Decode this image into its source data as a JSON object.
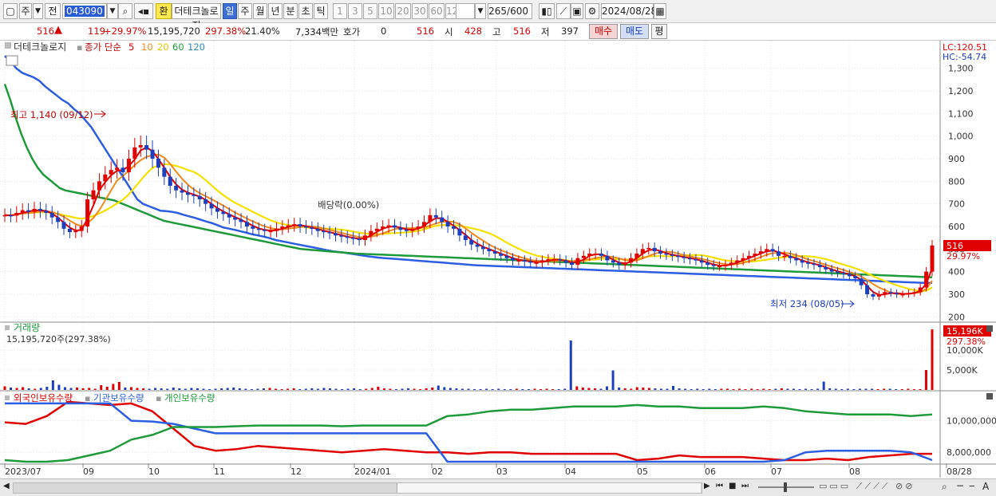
{
  "toolbar": {
    "unit": "주",
    "prefix": "전",
    "code": "043090",
    "currency_btn": "환",
    "stock_name": "더테크놀로지",
    "periods": [
      "일",
      "주",
      "월",
      "년",
      "분",
      "초",
      "틱"
    ],
    "intervals": [
      "1",
      "3",
      "5",
      "10",
      "20",
      "30",
      "60",
      "120"
    ],
    "count": "265",
    "count_total": "/600",
    "date": "2024/08/28"
  },
  "quote": {
    "price": "516",
    "change": "119",
    "change_pct": "+29.97%",
    "volume": "15,195,720",
    "volume_ratio": "297.38%",
    "turnover": "21.40%",
    "amount": "7,334백만",
    "hoga_label": "호가",
    "hoga_value": "0",
    "hoga_price": "516",
    "open_label": "시",
    "open": "428",
    "high_label": "고",
    "high": "516",
    "low_label": "저",
    "low": "397",
    "buy_btn": "매수",
    "sell_btn": "매도",
    "eval_btn": "평"
  },
  "colors": {
    "up": "#e00000",
    "down": "#1b3fbf",
    "ma5": "#e00000",
    "ma10": "#f08a1a",
    "ma20": "#f5e000",
    "ma60": "#1f9a3a",
    "ma120": "#2b5ee0",
    "foreign": "#e00000",
    "inst": "#2b5ee0",
    "retail": "#1f9a3a"
  },
  "chart_data": [
    {
      "type": "candlestick",
      "title": "더테크놀로지",
      "legend": [
        "종가 단순",
        "5",
        "10",
        "20",
        "60",
        "120"
      ],
      "ylim": [
        180,
        1380
      ],
      "y_ticks": [
        "1,300",
        "1,200",
        "1,100",
        "1,000",
        "900",
        "800",
        "700",
        "600",
        "500",
        "400",
        "300",
        "200"
      ],
      "x_ticks": [
        "2023/07",
        "09",
        "10",
        "11",
        "12",
        "2024/01",
        "02",
        "03",
        "04",
        "05",
        "06",
        "07",
        "08",
        "08/28"
      ],
      "lc": "LC:120.51",
      "hc": "HC:-54.74",
      "last_price": "516",
      "last_change": "29.97%",
      "annotations": {
        "high": "최고 1,140 (09/12)",
        "low": "최저 234 (08/05)",
        "dividend": "배당락(0.00%)"
      },
      "close": [
        650,
        648,
        660,
        672,
        665,
        678,
        670,
        660,
        640,
        620,
        590,
        575,
        580,
        600,
        720,
        760,
        800,
        830,
        850,
        860,
        840,
        900,
        950,
        960,
        940,
        900,
        860,
        820,
        780,
        760,
        750,
        740,
        735,
        720,
        700,
        680,
        665,
        655,
        640,
        630,
        620,
        600,
        590,
        585,
        580,
        580,
        590,
        600,
        605,
        610,
        600,
        595,
        590,
        580,
        575,
        570,
        560,
        555,
        550,
        545,
        540,
        560,
        580,
        590,
        600,
        605,
        595,
        585,
        580,
        590,
        600,
        620,
        650,
        640,
        620,
        600,
        590,
        560,
        540,
        520,
        510,
        500,
        490,
        480,
        470,
        460,
        450,
        450,
        445,
        440,
        440,
        450,
        455,
        455,
        450,
        440,
        430,
        460,
        470,
        480,
        480,
        470,
        450,
        440,
        430,
        440,
        460,
        480,
        500,
        505,
        490,
        480,
        475,
        470,
        465,
        460,
        455,
        450,
        440,
        430,
        425,
        425,
        430,
        440,
        450,
        460,
        470,
        480,
        490,
        500,
        490,
        470,
        470,
        460,
        450,
        440,
        435,
        430,
        420,
        410,
        400,
        395,
        390,
        380,
        370,
        340,
        300,
        290,
        300,
        310,
        305,
        300,
        300,
        305,
        310,
        330,
        400,
        516
      ],
      "ma120": [
        1355,
        1330,
        1300,
        1280,
        1270,
        1260,
        1245,
        1220,
        1200,
        1180,
        1160,
        1145,
        1120,
        1100,
        1070,
        1040,
        1000,
        960,
        920,
        880,
        840,
        800,
        760,
        720,
        700,
        690,
        680,
        670,
        668,
        665,
        660,
        652,
        645,
        638,
        630,
        622,
        615,
        605,
        595,
        590,
        585,
        578,
        572,
        565,
        560,
        555,
        548,
        540,
        535,
        530,
        525,
        520,
        515,
        510,
        505,
        500,
        495,
        490,
        487,
        484,
        480,
        476,
        472,
        468,
        465,
        462,
        460,
        458,
        456,
        454,
        452,
        450,
        448,
        446,
        444,
        442,
        440,
        438,
        436,
        434,
        432,
        430,
        428,
        427,
        426,
        425,
        424,
        423,
        422,
        421,
        420,
        419,
        418,
        417,
        416,
        415,
        414,
        413,
        412,
        411,
        410,
        409,
        408,
        407,
        406,
        405,
        404,
        403,
        402,
        401,
        400,
        399,
        398,
        397,
        396,
        395,
        394,
        393,
        392,
        391,
        390,
        389,
        388,
        387,
        386,
        385,
        384,
        383,
        382,
        381,
        380,
        379,
        378,
        377,
        376,
        375,
        374,
        373,
        372,
        371,
        370,
        369,
        368,
        367,
        366,
        365,
        364,
        363,
        362,
        361,
        360,
        359,
        358,
        357,
        356,
        355,
        354,
        353,
        352,
        351,
        350,
        350
      ],
      "ma60": [
        1230,
        1160,
        1080,
        1010,
        950,
        900,
        860,
        830,
        810,
        790,
        770,
        760,
        755,
        750,
        745,
        740,
        735,
        730,
        725,
        720,
        715,
        705,
        695,
        685,
        675,
        665,
        655,
        645,
        635,
        625,
        620,
        615,
        610,
        605,
        600,
        595,
        590,
        585,
        580,
        575,
        570,
        565,
        560,
        555,
        550,
        545,
        540,
        535,
        530,
        525,
        520,
        515,
        510,
        505,
        500,
        498,
        496,
        494,
        492,
        490,
        488,
        486,
        484,
        482,
        480,
        479,
        478,
        477,
        476,
        475,
        474,
        473,
        472,
        471,
        470,
        469,
        468,
        467,
        466,
        465,
        464,
        463,
        462,
        461,
        460,
        459,
        458,
        457,
        456,
        455,
        454,
        453,
        452,
        451,
        450,
        449,
        448,
        447,
        446,
        445,
        444,
        443,
        442,
        441,
        440,
        439,
        438,
        437,
        436,
        435,
        434,
        433,
        432,
        431,
        430,
        429,
        428,
        427,
        426,
        425,
        424,
        423,
        422,
        421,
        420,
        419,
        418,
        417,
        416,
        415,
        414,
        413,
        412,
        411,
        410,
        409,
        408,
        407,
        406,
        405,
        404,
        403,
        402,
        401,
        400,
        399,
        398,
        397,
        396,
        395,
        394,
        393,
        392,
        391,
        390,
        389,
        388,
        387,
        386,
        385,
        384,
        383,
        382,
        381,
        380,
        379,
        378,
        377,
        376,
        375
      ]
    },
    {
      "type": "bar",
      "title": "거래량",
      "value_label": "15,195,720주(297.38%)",
      "last_label": "15,196K",
      "last_pct": "297.38%",
      "y_ticks": [
        "10,000K",
        "5,000K"
      ],
      "ylim": [
        0,
        16000
      ],
      "values": [
        900,
        600,
        500,
        700,
        400,
        300,
        500,
        800,
        2400,
        1300,
        700,
        500,
        600,
        400,
        500,
        300,
        1200,
        800,
        1500,
        2000,
        600,
        700,
        500,
        400,
        300,
        500,
        400,
        300,
        600,
        400,
        300,
        500,
        400,
        300,
        200,
        300,
        400,
        500,
        600,
        400,
        300,
        200,
        300,
        400,
        500,
        300,
        200,
        300,
        400,
        200,
        300,
        400,
        300,
        500,
        400,
        300,
        200,
        300,
        400,
        200,
        300,
        500,
        800,
        400,
        300,
        200,
        300,
        400,
        300,
        200,
        400,
        600,
        1100,
        700,
        500,
        400,
        300,
        300,
        200,
        200,
        300,
        200,
        300,
        200,
        200,
        300,
        200,
        200,
        300,
        200,
        300,
        200,
        200,
        300,
        12400,
        900,
        600,
        500,
        400,
        300,
        900,
        4900,
        600,
        400,
        300,
        700,
        600,
        500,
        400,
        300,
        300,
        1000,
        400,
        300,
        200,
        300,
        200,
        300,
        200,
        300,
        300,
        200,
        300,
        200,
        300,
        200,
        300,
        200,
        300,
        400,
        300,
        300,
        200,
        300,
        200,
        300,
        2100,
        400,
        300,
        200,
        300,
        200,
        300,
        300,
        300,
        200,
        300,
        300,
        200,
        200,
        300,
        200,
        200,
        5000,
        15196
      ]
    },
    {
      "type": "line",
      "legend": [
        "외국인보유수량",
        "기관보유수량",
        "개인보유수량"
      ],
      "y_ticks": [
        "10,000,000",
        "8,000,000"
      ],
      "ylim": [
        7300000,
        11600000
      ],
      "series": [
        {
          "name": "외국인보유수량",
          "values": [
            9900000,
            9800000,
            10300000,
            11200000,
            11100000,
            11000000,
            11100000,
            10600000,
            9500000,
            8400000,
            8100000,
            8200000,
            8400000,
            8300000,
            8200000,
            8100000,
            8000000,
            8100000,
            8200000,
            8100000,
            8000000,
            8000000,
            7900000,
            8000000,
            8000000,
            7900000,
            7900000,
            7900000,
            7900000,
            7900000,
            7500000,
            7600000,
            7800000,
            7700000,
            7700000,
            7700000,
            7600000,
            7500000,
            7500000,
            7600000,
            7500000,
            7700000,
            7800000,
            7900000,
            7900000
          ]
        },
        {
          "name": "기관보유수량",
          "values": [
            11100000,
            11100000,
            11100000,
            11100000,
            11100000,
            11100000,
            10000000,
            9950000,
            9800000,
            9500000,
            9200000,
            9200000,
            9200000,
            9200000,
            9200000,
            9200000,
            9200000,
            9200000,
            9200000,
            9200000,
            9200000,
            7400000,
            7400000,
            7400000,
            7400000,
            7400000,
            7400000,
            7400000,
            7400000,
            7400000,
            7400000,
            7400000,
            7400000,
            7400000,
            7400000,
            7400000,
            7400000,
            7500000,
            8000000,
            8100000,
            8100000,
            8100000,
            8100000,
            8000000,
            7500000
          ]
        },
        {
          "name": "개인보유수량",
          "values": [
            7500000,
            7400000,
            7400000,
            7500000,
            7800000,
            8100000,
            8800000,
            9100000,
            9600000,
            9600000,
            9600000,
            9650000,
            9700000,
            9700000,
            9700000,
            9700000,
            9650000,
            9700000,
            9700000,
            9700000,
            9700000,
            10300000,
            10400000,
            10600000,
            10700000,
            10700000,
            10800000,
            10900000,
            10900000,
            10900000,
            11000000,
            10900000,
            10900000,
            10800000,
            10800000,
            10800000,
            10900000,
            10800000,
            10600000,
            10500000,
            10400000,
            10400000,
            10400000,
            10300000,
            10400000
          ]
        }
      ]
    }
  ],
  "bottom": {
    "icons": [
      "scroll-left",
      "scroll-right",
      "first",
      "stop",
      "last",
      "zoom",
      "add-chart"
    ]
  }
}
